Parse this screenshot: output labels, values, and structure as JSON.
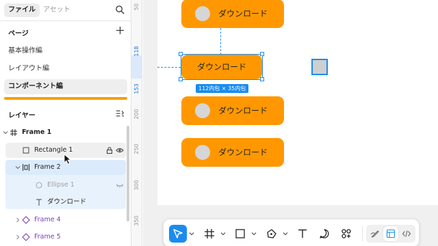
{
  "tabs": {
    "files": "ファイル",
    "assets": "アセット"
  },
  "pages": {
    "title": "ページ",
    "items": [
      {
        "label": "基本操作編",
        "active": false
      },
      {
        "label": "レイアウト編",
        "active": false
      },
      {
        "label": "コンポーネント編",
        "active": true
      }
    ]
  },
  "layers": {
    "title": "レイヤー",
    "items": [
      {
        "label": "Frame 1"
      },
      {
        "label": "Rectangle 1"
      },
      {
        "label": "Frame 2"
      },
      {
        "label": "Ellipse 1"
      },
      {
        "label": "ダウンロード"
      },
      {
        "label": "Frame 4"
      },
      {
        "label": "Frame 5"
      }
    ]
  },
  "ruler": {
    "ticks": [
      "50",
      "118",
      "153",
      "200",
      "250",
      "300",
      "350"
    ]
  },
  "canvas": {
    "button_label": "ダウンロード",
    "size_badge": "112内包 × 35内包"
  },
  "colors": {
    "accent": "#1a8cf0",
    "button": "#ff9800",
    "frame": "#7b3db8"
  },
  "icons": [
    "search-icon",
    "plus-icon",
    "layers-sort-icon",
    "frame-icon",
    "rectangle-icon",
    "lock-icon",
    "eye-icon",
    "autolayout-icon",
    "ellipse-icon",
    "hidden-icon",
    "text-icon",
    "component-icon",
    "move-icon",
    "shape-icon",
    "pen-icon",
    "comment-icon",
    "actions-icon",
    "draw-mode-icon",
    "design-mode-icon",
    "dev-mode-icon"
  ]
}
